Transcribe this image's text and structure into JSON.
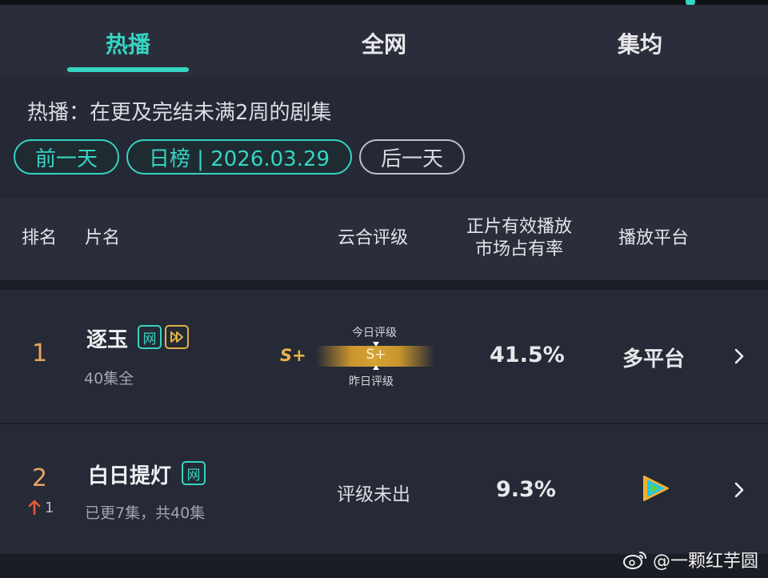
{
  "tabs": [
    {
      "label": "热播",
      "active": true
    },
    {
      "label": "全网",
      "active": false
    },
    {
      "label": "集均",
      "active": false
    }
  ],
  "filter": {
    "description": "热播：在更及完结未满2周的剧集",
    "prev_day": "前一天",
    "date_label": "日榜 | 2026.03.29",
    "next_day": "后一天"
  },
  "table": {
    "headers": {
      "rank": "排名",
      "title": "片名",
      "rating": "云合评级",
      "share_line1": "正片有效播放",
      "share_line2": "市场占有率",
      "platform": "播放平台"
    },
    "rows": [
      {
        "rank": "1",
        "title": "逐玉",
        "net_badge": "网",
        "episodes": "40集全",
        "grade_yesterday": "S+",
        "grade_today": "S+",
        "today_label": "今日评级",
        "yesterday_label": "昨日评级",
        "share": "41.5%",
        "platform": "多平台"
      },
      {
        "rank": "2",
        "rank_change": "1",
        "title": "白日提灯",
        "net_badge": "网",
        "episodes": "已更7集，共40集",
        "rating": "评级未出",
        "share": "9.3%",
        "platform_icon": "tencent-video-icon"
      }
    ]
  },
  "watermark": {
    "user": "@一颗红芋圆"
  },
  "colors": {
    "accent": "#36d4c2",
    "gold": "#e0b047",
    "rank": "#e9a562",
    "background": "#1b1d25"
  }
}
